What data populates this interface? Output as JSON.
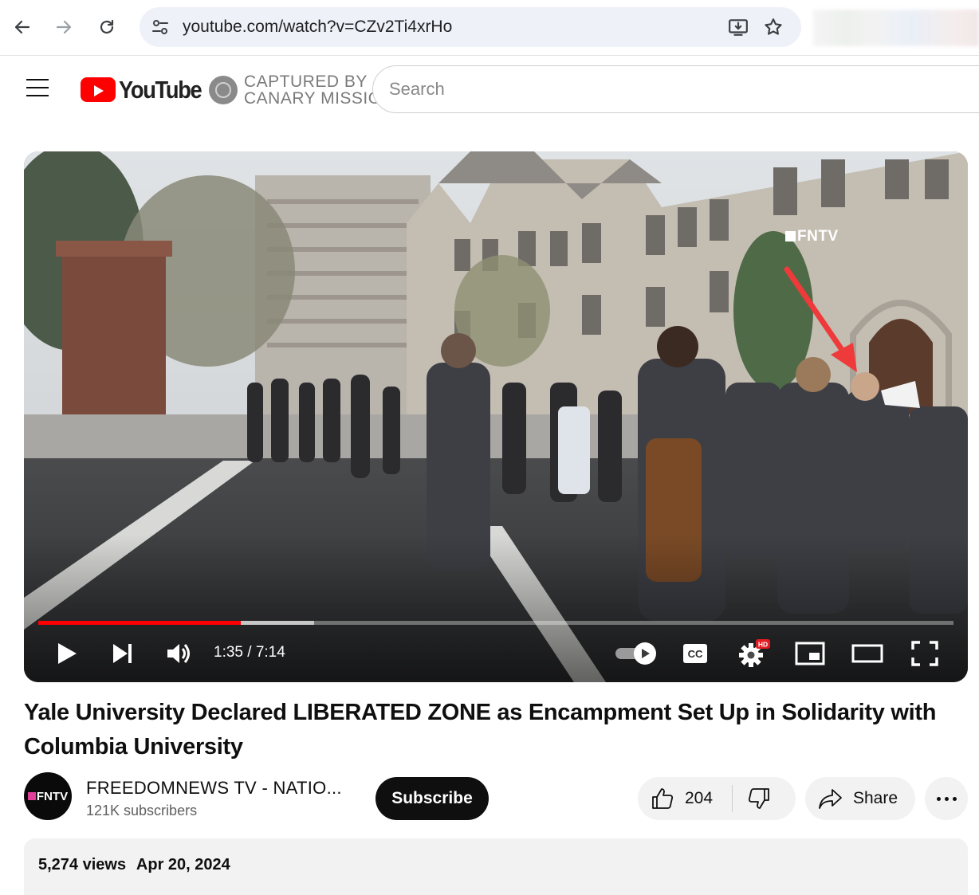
{
  "browser": {
    "url": "youtube.com/watch?v=CZv2Ti4xrHo"
  },
  "header": {
    "logo_text": "YouTube",
    "overlay_line1": "CAPTURED BY",
    "overlay_line2": "CANARY MISSION",
    "search_placeholder": "Search"
  },
  "player": {
    "watermark": "FNTV",
    "time_display": "1:35 / 7:14",
    "progress_fraction": 0.221,
    "buffered_fraction": 0.301,
    "hd_badge": "HD",
    "accent_color": "#ff0000"
  },
  "video": {
    "title": "Yale University Declared LIBERATED ZONE as Encampment Set Up in Solidarity with Columbia University"
  },
  "channel": {
    "avatar_text": "FNTV",
    "name": "FREEDOMNEWS TV - NATIO...",
    "subscribers": "121K subscribers",
    "subscribe_label": "Subscribe"
  },
  "actions": {
    "like_count": "204",
    "share_label": "Share"
  },
  "description": {
    "views": "5,274 views",
    "date": "Apr 20, 2024"
  },
  "icons": [
    "back-icon",
    "forward-icon",
    "reload-icon",
    "site-settings-icon",
    "install-app-icon",
    "star-icon",
    "hamburger-icon",
    "play-icon",
    "next-icon",
    "volume-icon",
    "autoplay-toggle-icon",
    "captions-icon",
    "settings-icon",
    "miniplayer-icon",
    "theater-icon",
    "fullscreen-icon",
    "like-icon",
    "dislike-icon",
    "share-icon",
    "more-icon"
  ]
}
